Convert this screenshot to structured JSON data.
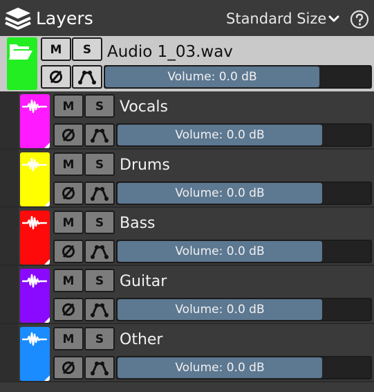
{
  "header": {
    "title": "Layers",
    "size_label": "Standard Size",
    "icons": {
      "layers": "layers-icon",
      "chevron": "chevron-down-icon",
      "help": "help-icon"
    }
  },
  "parent_layer": {
    "name": "Audio 1_03.wav",
    "color": "#22ee22",
    "icon": "folder-open-icon",
    "mute_label": "M",
    "solo_label": "S",
    "volume_label": "Volume: 0.0 dB",
    "volume_fraction": 0.8
  },
  "layers": [
    {
      "name": "Vocals",
      "color": "#ff1aff",
      "mute_label": "M",
      "solo_label": "S",
      "volume_label": "Volume: 0.0 dB",
      "volume_fraction": 0.8
    },
    {
      "name": "Drums",
      "color": "#ffff00",
      "mute_label": "M",
      "solo_label": "S",
      "volume_label": "Volume: 0.0 dB",
      "volume_fraction": 0.8
    },
    {
      "name": "Bass",
      "color": "#ff0a0a",
      "mute_label": "M",
      "solo_label": "S",
      "volume_label": "Volume: 0.0 dB",
      "volume_fraction": 0.8
    },
    {
      "name": "Guitar",
      "color": "#8a0aff",
      "mute_label": "M",
      "solo_label": "S",
      "volume_label": "Volume: 0.0 dB",
      "volume_fraction": 0.8
    },
    {
      "name": "Other",
      "color": "#1a8cff",
      "mute_label": "M",
      "solo_label": "S",
      "volume_label": "Volume: 0.0 dB",
      "volume_fraction": 0.8
    }
  ]
}
